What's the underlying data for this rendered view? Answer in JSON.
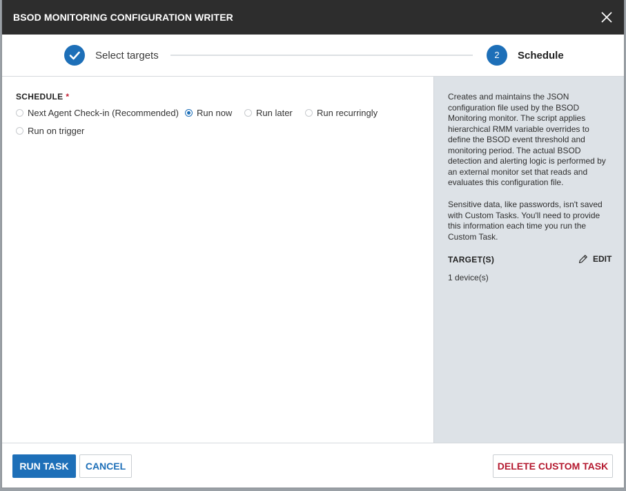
{
  "dialog": {
    "title": "BSOD MONITORING CONFIGURATION WRITER",
    "close_icon": "close-icon"
  },
  "stepper": {
    "steps": [
      {
        "label": "Select targets",
        "status": "completed",
        "icon": "checkmark-icon"
      },
      {
        "label": "Schedule",
        "number": "2",
        "status": "active"
      }
    ]
  },
  "schedule": {
    "label": "SCHEDULE",
    "required_marker": "*",
    "selected": "Run now",
    "options": [
      {
        "label": "Next Agent Check-in (Recommended)",
        "selected": false
      },
      {
        "label": "Run now",
        "selected": true
      },
      {
        "label": "Run later",
        "selected": false
      },
      {
        "label": "Run recurringly",
        "selected": false
      },
      {
        "label": "Run on trigger",
        "selected": false
      }
    ]
  },
  "sidebar": {
    "description": "Creates and maintains the JSON configuration file used by the BSOD Monitoring monitor. The script applies hierarchical RMM variable overrides to define the BSOD event threshold and monitoring period. The actual BSOD detection and alerting logic is performed by an external monitor set that reads and evaluates this configuration file.",
    "sensitive_note": "Sensitive data, like passwords, isn't saved with Custom Tasks. You'll need to provide this information each time you run the Custom Task.",
    "targets_label": "TARGET(S)",
    "edit_label": "EDIT",
    "edit_icon": "pencil-icon",
    "targets_value": "1 device(s)"
  },
  "footer": {
    "run_label": "RUN TASK",
    "cancel_label": "CANCEL",
    "delete_label": "DELETE CUSTOM TASK"
  },
  "colors": {
    "titlebar": "#2d2d2d",
    "accent": "#1d6fb8",
    "danger": "#b4182e",
    "sidepanel": "#dde2e7"
  }
}
